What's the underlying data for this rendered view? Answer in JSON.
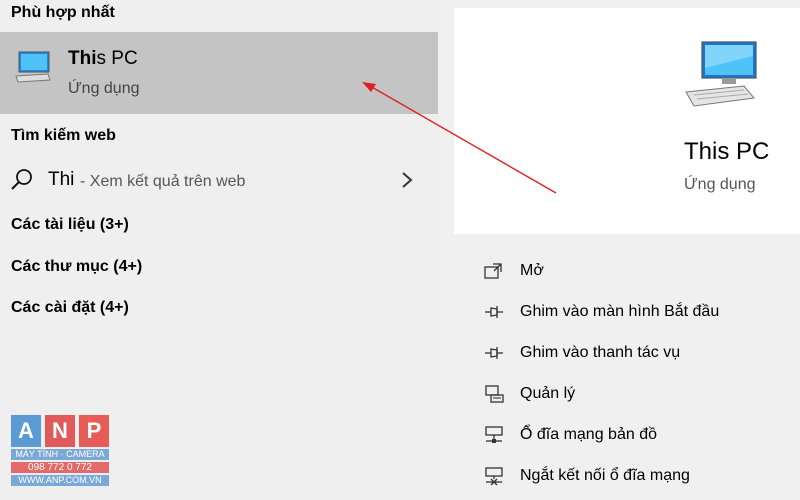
{
  "best_match": {
    "heading": "Phù hợp nhất",
    "title_bold": "Thi",
    "title_rest": "s PC",
    "subtitle": "Ứng dụng"
  },
  "web": {
    "heading": "Tìm kiếm web",
    "query": "Thi",
    "hint": "- Xem kết quả trên web"
  },
  "categories": [
    "Các tài liệu (3+)",
    "Các thư mục (4+)",
    "Các cài đặt (4+)"
  ],
  "detail": {
    "title": "This PC",
    "subtitle": "Ứng dụng"
  },
  "actions": [
    {
      "label": "Mở",
      "icon": "open-icon"
    },
    {
      "label": "Ghim vào màn hình Bắt đầu",
      "icon": "pin-icon"
    },
    {
      "label": "Ghim vào thanh tác vụ",
      "icon": "pin-icon"
    },
    {
      "label": "Quản lý",
      "icon": "manage-icon"
    },
    {
      "label": "Ổ đĩa mạng bản đồ",
      "icon": "map-drive-icon"
    },
    {
      "label": "Ngắt kết nối ổ đĩa mạng",
      "icon": "disconnect-drive-icon"
    }
  ],
  "logo": {
    "letters": [
      "A",
      "N",
      "P"
    ],
    "tagline": "MÁY TÍNH · CAMERA",
    "phone": "098 772 0 772",
    "site": "WWW.ANP.COM.VN"
  },
  "colors": {
    "selected_row": "#c4c4c4",
    "pane_bg": "#f0f0f0",
    "detail_bg": "#ffffff",
    "annotation_arrow": "#e02020"
  }
}
